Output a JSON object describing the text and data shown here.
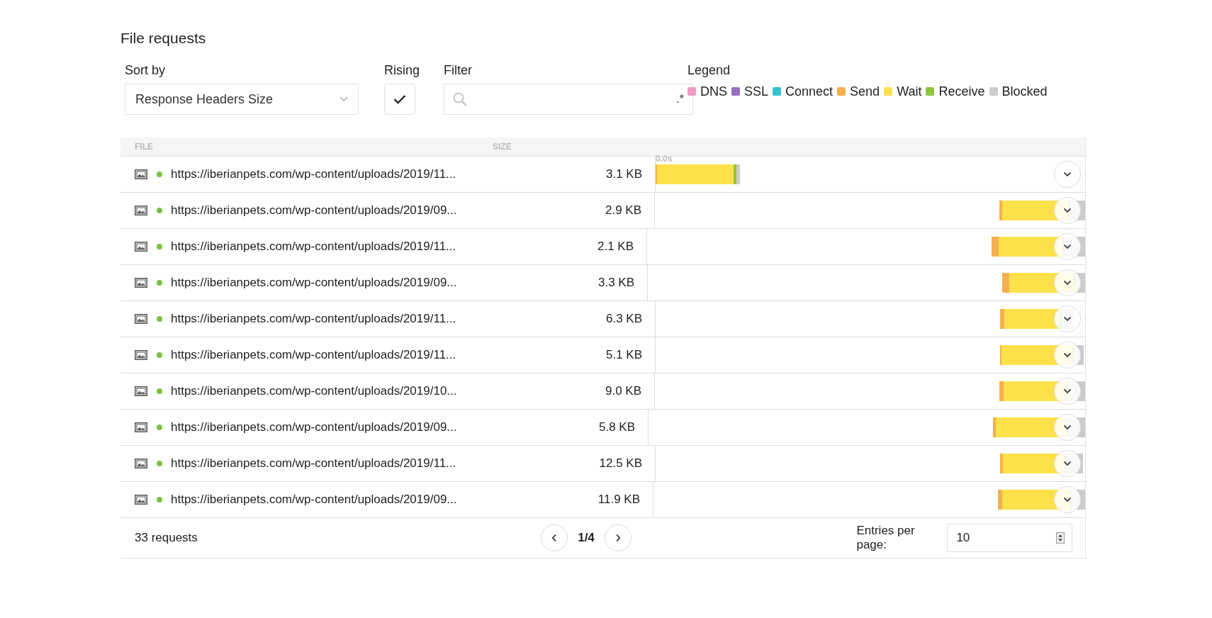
{
  "title": "File requests",
  "controls": {
    "sort_label": "Sort by",
    "sort_value": "Response Headers Size",
    "rising_label": "Rising",
    "rising_checked": true,
    "filter_label": "Filter",
    "filter_regex": ".*"
  },
  "legend": {
    "label": "Legend",
    "items": [
      {
        "name": "DNS",
        "color": "#f29ac4"
      },
      {
        "name": "SSL",
        "color": "#9a6fbd"
      },
      {
        "name": "Connect",
        "color": "#35c1d4"
      },
      {
        "name": "Send",
        "color": "#f4b04f"
      },
      {
        "name": "Wait",
        "color": "#fde14b"
      },
      {
        "name": "Receive",
        "color": "#8cc63f"
      },
      {
        "name": "Blocked",
        "color": "#cccccc"
      }
    ]
  },
  "table": {
    "columns": [
      "FILE",
      "SIZE"
    ],
    "axis_label": "0.0s",
    "rows": [
      {
        "url": "https://iberianpets.com/wp-content/uploads/2019/11...",
        "size": "3.1 KB"
      },
      {
        "url": "https://iberianpets.com/wp-content/uploads/2019/09...",
        "size": "2.9 KB"
      },
      {
        "url": "https://iberianpets.com/wp-content/uploads/2019/11...",
        "size": "2.1 KB"
      },
      {
        "url": "https://iberianpets.com/wp-content/uploads/2019/09...",
        "size": "3.3 KB"
      },
      {
        "url": "https://iberianpets.com/wp-content/uploads/2019/11...",
        "size": "6.3 KB"
      },
      {
        "url": "https://iberianpets.com/wp-content/uploads/2019/11...",
        "size": "5.1 KB"
      },
      {
        "url": "https://iberianpets.com/wp-content/uploads/2019/10...",
        "size": "9.0 KB"
      },
      {
        "url": "https://iberianpets.com/wp-content/uploads/2019/09...",
        "size": "5.8 KB"
      },
      {
        "url": "https://iberianpets.com/wp-content/uploads/2019/11...",
        "size": "12.5 KB"
      },
      {
        "url": "https://iberianpets.com/wp-content/uploads/2019/09...",
        "size": "11.9 KB"
      }
    ]
  },
  "footer": {
    "count": "33 requests",
    "page": "1/4",
    "entries_label": "Entries per page:",
    "entries_value": "10"
  }
}
